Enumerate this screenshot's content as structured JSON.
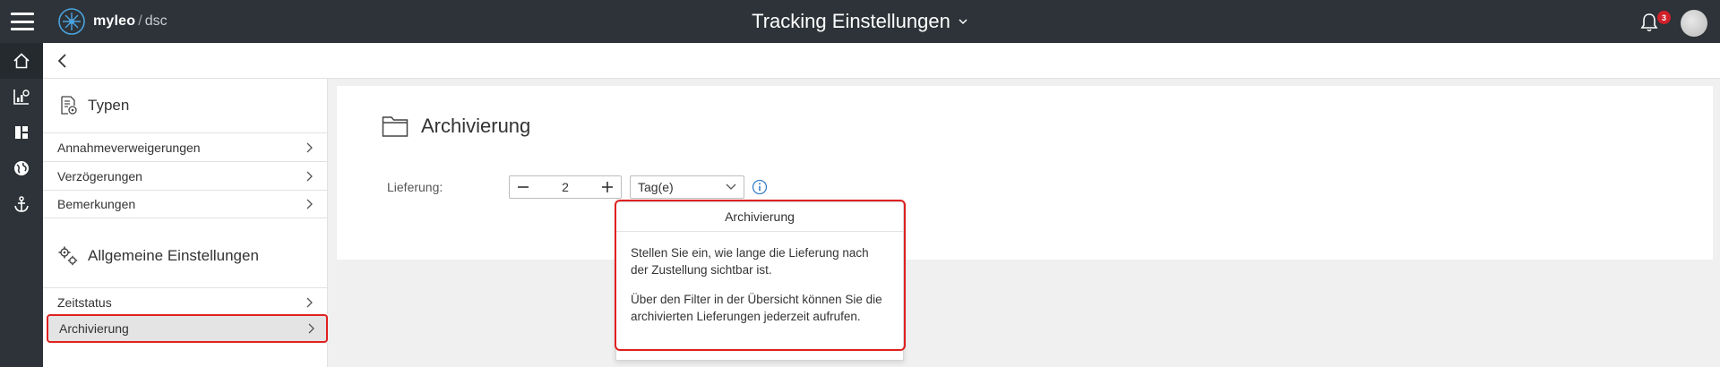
{
  "header": {
    "brand": "myleo",
    "brand_separator": "/",
    "brand_suffix": "dsc",
    "title": "Tracking Einstellungen",
    "notification_count": "3"
  },
  "rail": {
    "items": [
      {
        "icon": "home-icon"
      },
      {
        "icon": "chart-icon"
      },
      {
        "icon": "dashboard-icon"
      },
      {
        "icon": "globe-icon"
      },
      {
        "icon": "anchor-icon"
      }
    ]
  },
  "nav": {
    "section_types": "Typen",
    "types_items": [
      {
        "label": "Annahmeverweigerungen"
      },
      {
        "label": "Verzögerungen"
      },
      {
        "label": "Bemerkungen"
      }
    ],
    "section_general": "Allgemeine Einstellungen",
    "general_items": [
      {
        "label": "Zeitstatus"
      },
      {
        "label": "Archivierung",
        "selected": true
      }
    ]
  },
  "main": {
    "title": "Archivierung",
    "field_label": "Lieferung:",
    "stepper_value": "2",
    "unit_value": "Tag(e)"
  },
  "popover": {
    "title": "Archivierung",
    "paragraph1": "Stellen Sie ein, wie lange die Lieferung nach der Zustellung sichtbar ist.",
    "paragraph2": "Über den Filter in der Übersicht können Sie die archivierten Lieferungen jederzeit aufrufen."
  },
  "colors": {
    "topbar": "#2d3338",
    "highlight": "#e02020",
    "badge": "#d0202a",
    "info_accent": "#3b7ec8"
  }
}
